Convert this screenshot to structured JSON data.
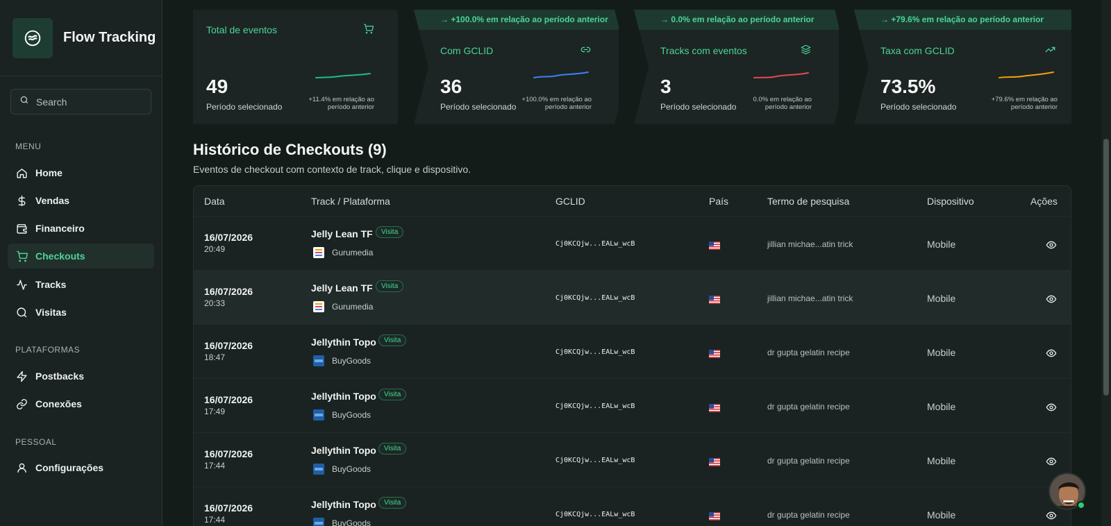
{
  "brand": {
    "title": "Flow Tracking"
  },
  "search": {
    "placeholder": "Search"
  },
  "sections": {
    "menu": "MENU",
    "platforms": "PLATAFORMAS",
    "personal": "PESSOAL"
  },
  "nav": {
    "home": "Home",
    "vendas": "Vendas",
    "financeiro": "Financeiro",
    "checkouts": "Checkouts",
    "tracks": "Tracks",
    "visitas": "Visitas",
    "postbacks": "Postbacks",
    "conexoes": "Conexões",
    "configuracoes": "Configurações"
  },
  "kpis": [
    {
      "title": "Total de eventos",
      "icon": "cart-icon",
      "value": "49",
      "sub": "Período selecionado",
      "delta": "+11.4% em relação ao período anterior",
      "band": "",
      "color": "#1fbf84"
    },
    {
      "title": "Com GCLID",
      "icon": "link-icon",
      "value": "36",
      "sub": "Período selecionado",
      "delta": "+100.0% em relação ao período anterior",
      "band": "→ +100.0% em relação ao período anterior",
      "color": "#3b82f6"
    },
    {
      "title": "Tracks com eventos",
      "icon": "layers-icon",
      "value": "3",
      "sub": "Período selecionado",
      "delta": "0.0% em relação ao período anterior",
      "band": "→ 0.0% em relação ao período anterior",
      "color": "#e5484d"
    },
    {
      "title": "Taxa com GCLID",
      "icon": "trend-up-icon",
      "value": "73.5%",
      "sub": "Período selecionado",
      "delta": "+79.6% em relação ao período anterior",
      "band": "→ +79.6% em relação ao período anterior",
      "color": "#f59e0b"
    }
  ],
  "page": {
    "title": "Histórico de Checkouts (9)",
    "subtitle": "Eventos de checkout com contexto de track, clique e dispositivo."
  },
  "table": {
    "headers": {
      "date": "Data",
      "track": "Track / Plataforma",
      "gclid": "GCLID",
      "country": "País",
      "term": "Termo de pesquisa",
      "device": "Dispositivo",
      "actions": "Ações"
    },
    "badge": "Visita",
    "rows": [
      {
        "date": "16/07/2026",
        "time": "20:49",
        "track": "Jelly Lean TF",
        "platform": "Gurumedia",
        "gclid": "Cj0KCQjw...EALw_wcB",
        "term": "jillian michae...atin trick",
        "device": "Mobile"
      },
      {
        "date": "16/07/2026",
        "time": "20:33",
        "track": "Jelly Lean TF",
        "platform": "Gurumedia",
        "gclid": "Cj0KCQjw...EALw_wcB",
        "term": "jillian michae...atin trick",
        "device": "Mobile"
      },
      {
        "date": "16/07/2026",
        "time": "18:47",
        "track": "Jellythin Topo",
        "platform": "BuyGoods",
        "gclid": "Cj0KCQjw...EALw_wcB",
        "term": "dr gupta gelatin recipe",
        "device": "Mobile"
      },
      {
        "date": "16/07/2026",
        "time": "17:49",
        "track": "Jellythin Topo",
        "platform": "BuyGoods",
        "gclid": "Cj0KCQjw...EALw_wcB",
        "term": "dr gupta gelatin recipe",
        "device": "Mobile"
      },
      {
        "date": "16/07/2026",
        "time": "17:44",
        "track": "Jellythin Topo",
        "platform": "BuyGoods",
        "gclid": "Cj0KCQjw...EALw_wcB",
        "term": "dr gupta gelatin recipe",
        "device": "Mobile"
      },
      {
        "date": "16/07/2026",
        "time": "17:44",
        "track": "Jellythin Topo",
        "platform": "BuyGoods",
        "gclid": "Cj0KCQjw...EALw_wcB",
        "term": "dr gupta gelatin recipe",
        "device": "Mobile"
      }
    ]
  },
  "colors": {
    "accent": "#4cd49a",
    "background": "#141c1a",
    "sidebar": "#1a2321"
  }
}
